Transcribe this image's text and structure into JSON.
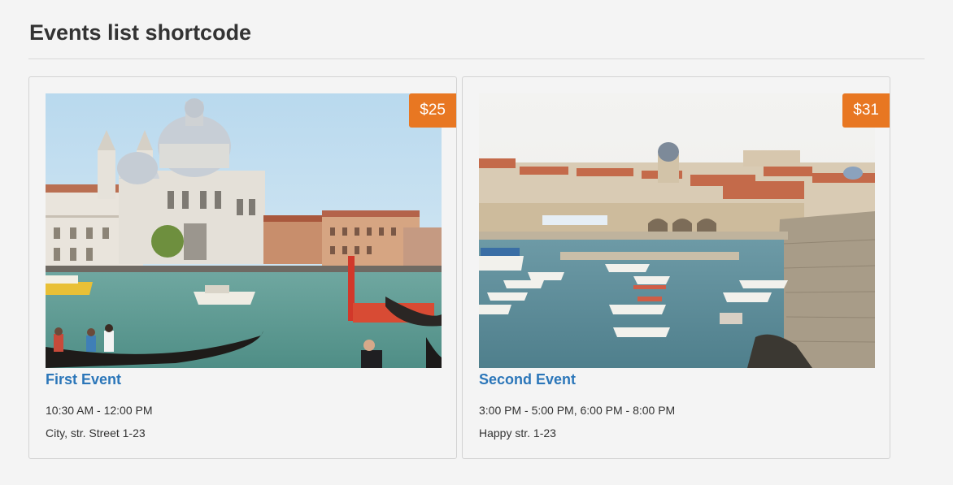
{
  "page": {
    "title": "Events list shortcode"
  },
  "events": [
    {
      "title": "First Event",
      "price": "$25",
      "time": "10:30 AM - 12:00 PM",
      "place": "City, str. Street 1-23",
      "image": "venice-canal-photo"
    },
    {
      "title": "Second Event",
      "price": "$31",
      "time": "3:00 PM - 5:00 PM, 6:00 PM - 8:00 PM",
      "place": "Happy str. 1-23",
      "image": "harbor-old-town-photo"
    }
  ],
  "colors": {
    "price_badge": "#e87722",
    "event_link": "#2b76b9",
    "background": "#f4f4f4"
  }
}
